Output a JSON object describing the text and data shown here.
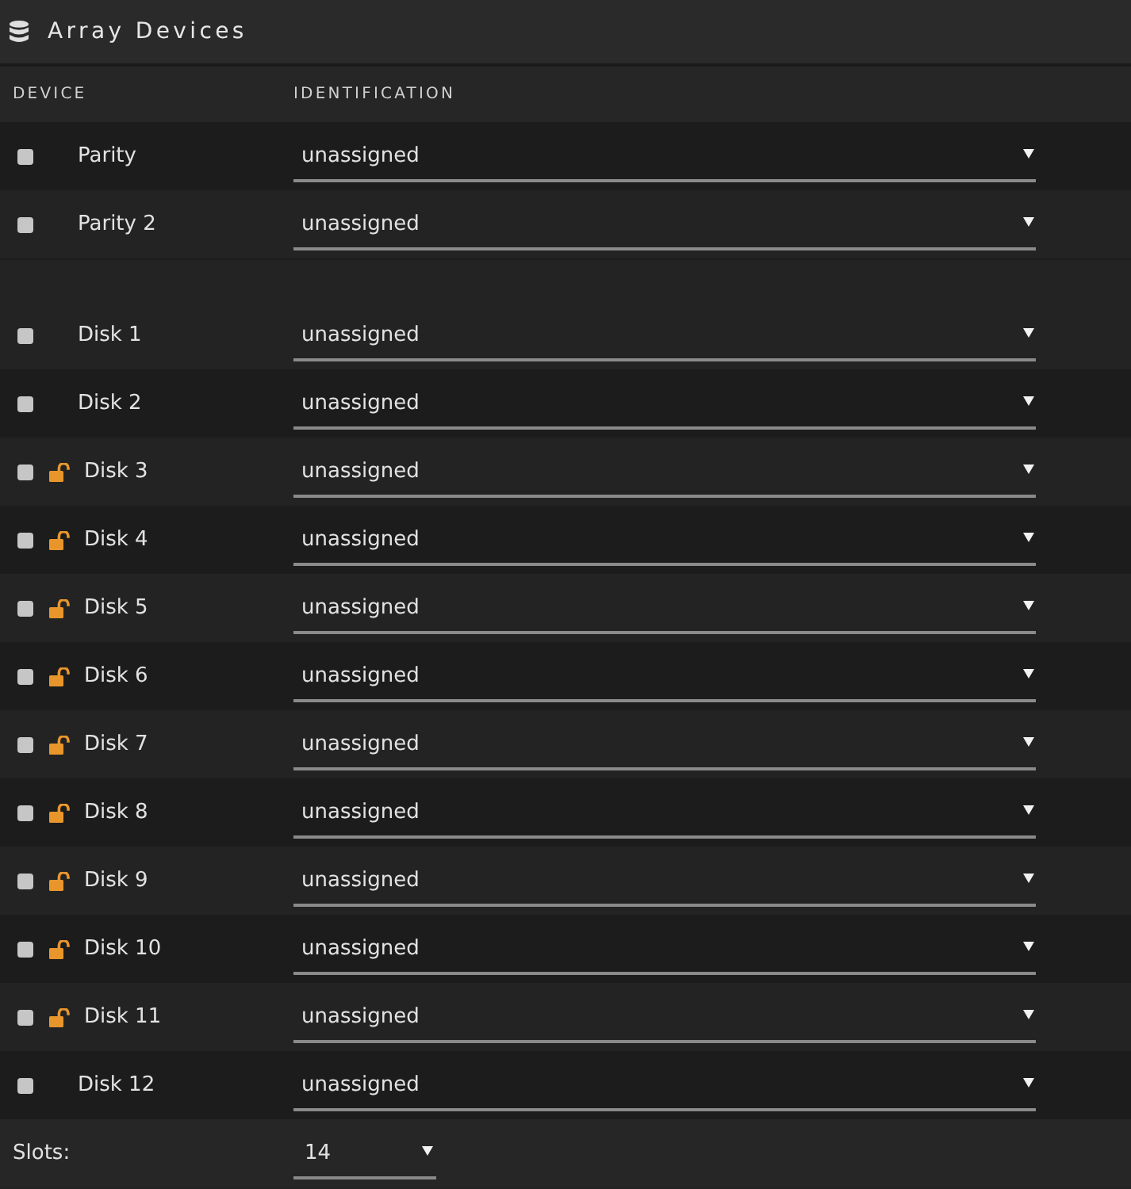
{
  "panel": {
    "title": "Array Devices"
  },
  "columns": [
    "DEVICE",
    "IDENTIFICATION"
  ],
  "groups": [
    {
      "rows": [
        {
          "name": "Parity",
          "checked": false,
          "unlocked": false,
          "identification": "unassigned"
        },
        {
          "name": "Parity 2",
          "checked": false,
          "unlocked": false,
          "identification": "unassigned"
        }
      ]
    },
    {
      "rows": [
        {
          "name": "Disk 1",
          "checked": false,
          "unlocked": false,
          "identification": "unassigned"
        },
        {
          "name": "Disk 2",
          "checked": false,
          "unlocked": false,
          "identification": "unassigned"
        },
        {
          "name": "Disk 3",
          "checked": false,
          "unlocked": true,
          "identification": "unassigned"
        },
        {
          "name": "Disk 4",
          "checked": false,
          "unlocked": true,
          "identification": "unassigned"
        },
        {
          "name": "Disk 5",
          "checked": false,
          "unlocked": true,
          "identification": "unassigned"
        },
        {
          "name": "Disk 6",
          "checked": false,
          "unlocked": true,
          "identification": "unassigned"
        },
        {
          "name": "Disk 7",
          "checked": false,
          "unlocked": true,
          "identification": "unassigned"
        },
        {
          "name": "Disk 8",
          "checked": false,
          "unlocked": true,
          "identification": "unassigned"
        },
        {
          "name": "Disk 9",
          "checked": false,
          "unlocked": true,
          "identification": "unassigned"
        },
        {
          "name": "Disk 10",
          "checked": false,
          "unlocked": true,
          "identification": "unassigned"
        },
        {
          "name": "Disk 11",
          "checked": false,
          "unlocked": true,
          "identification": "unassigned"
        },
        {
          "name": "Disk 12",
          "checked": false,
          "unlocked": false,
          "identification": "unassigned"
        }
      ]
    }
  ],
  "slots": {
    "label": "Slots:",
    "value": "14"
  }
}
